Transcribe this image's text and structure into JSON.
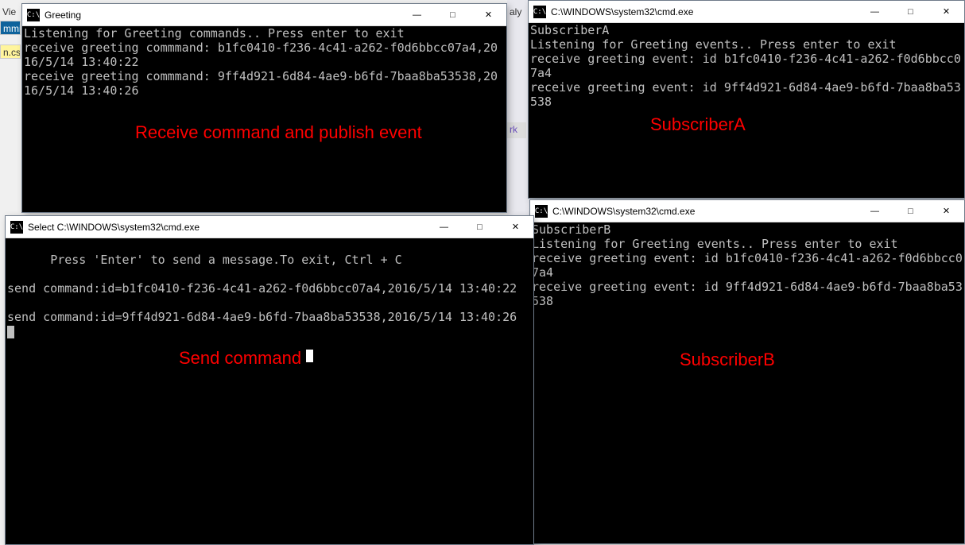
{
  "background": {
    "frag_vie": "Vie",
    "frag_mmi": "mmi",
    "frag_ncs": "n.cs",
    "frag_aly": "aly",
    "frag_rk": "rk"
  },
  "windows": {
    "greeting": {
      "title": "Greeting",
      "lines": "Listening for Greeting commands.. Press enter to exit\nreceive greeting commmand: b1fc0410-f236-4c41-a262-f0d6bbcc07a4,2016/5/14 13:40:22\nreceive greeting commmand: 9ff4d921-6d84-4ae9-b6fd-7baa8ba53538,2016/5/14 13:40:26",
      "overlay": "Receive command and publish event"
    },
    "sender": {
      "title": "Select C:\\WINDOWS\\system32\\cmd.exe",
      "lines": "Press 'Enter' to send a message.To exit, Ctrl + C\n\nsend command:id=b1fc0410-f236-4c41-a262-f0d6bbcc07a4,2016/5/14 13:40:22\n\nsend command:id=9ff4d921-6d84-4ae9-b6fd-7baa8ba53538,2016/5/14 13:40:26\n",
      "overlay": "Send command"
    },
    "subA": {
      "title": "C:\\WINDOWS\\system32\\cmd.exe",
      "lines": "SubscriberA\nListening for Greeting events.. Press enter to exit\nreceive greeting event: id b1fc0410-f236-4c41-a262-f0d6bbcc07a4\nreceive greeting event: id 9ff4d921-6d84-4ae9-b6fd-7baa8ba53538",
      "overlay": "SubscriberA"
    },
    "subB": {
      "title": "C:\\WINDOWS\\system32\\cmd.exe",
      "lines": "SubscriberB\nListening for Greeting events.. Press enter to exit\nreceive greeting event: id b1fc0410-f236-4c41-a262-f0d6bbcc07a4\nreceive greeting event: id 9ff4d921-6d84-4ae9-b6fd-7baa8ba53538",
      "overlay": "SubscriberB"
    }
  },
  "icons": {
    "cmd_glyph": "C:\\"
  },
  "colors": {
    "annotation": "#ff0000",
    "terminal_bg": "#000000",
    "terminal_fg": "#c0c0c0"
  }
}
